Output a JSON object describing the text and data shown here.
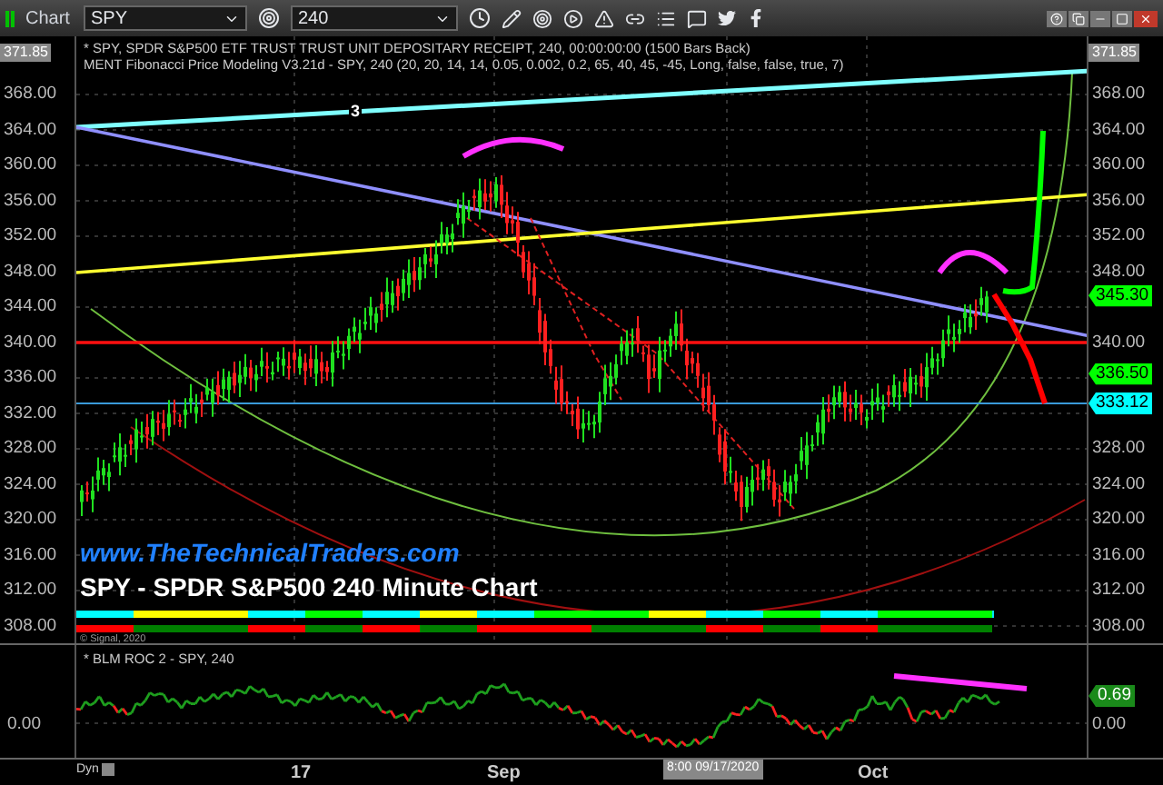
{
  "toolbar": {
    "title": "Chart",
    "symbol": "SPY",
    "interval": "240"
  },
  "price_pane": {
    "legend": [
      "* SPY, SPDR S&P500 ETF TRUST TRUST UNIT DEPOSITARY RECEIPT, 240, 00:00:00:00 (1500 Bars Back)",
      "MENT Fibonacci Price Modeling V3.21d - SPY, 240 (20, 20, 14, 14, 0.05, 0.002, 0.2, 65, 40, 45, -45, Long, false, false, true, 7)"
    ],
    "wave_marker": "3",
    "site_label": "www.TheTechnicalTraders.com",
    "chart_title": "SPY - SPDR S&P500 240 Minute Chart",
    "copyright": "© Signal, 2020",
    "left_axis": {
      "top_tag": "371.85",
      "labels": [
        "368.00",
        "364.00",
        "360.00",
        "356.00",
        "352.00",
        "348.00",
        "344.00",
        "340.00",
        "336.00",
        "332.00",
        "328.00",
        "324.00",
        "320.00",
        "316.00",
        "312.00",
        "308.00"
      ]
    },
    "right_axis": {
      "top_tag": "371.85",
      "labels": [
        "368.00",
        "364.00",
        "360.00",
        "356.00",
        "352.00",
        "348.00",
        "340.00",
        "328.00",
        "324.00",
        "320.00",
        "316.00",
        "312.00",
        "308.00"
      ],
      "tags": [
        {
          "text": "345.30",
          "color": "#00ff00"
        },
        {
          "text": "336.50",
          "color": "#00ff00"
        },
        {
          "text": "333.12",
          "color": "#00ffff"
        }
      ]
    }
  },
  "indicator_pane": {
    "legend": "* BLM ROC 2 - SPY, 240",
    "left_label": "0.00",
    "right_label": "0.00",
    "value_tag": "0.69"
  },
  "x_axis": {
    "mode": "Dyn",
    "labels": [
      "17",
      "Sep",
      "Oct"
    ],
    "cursor_label": "8:00 09/17/2020"
  }
}
